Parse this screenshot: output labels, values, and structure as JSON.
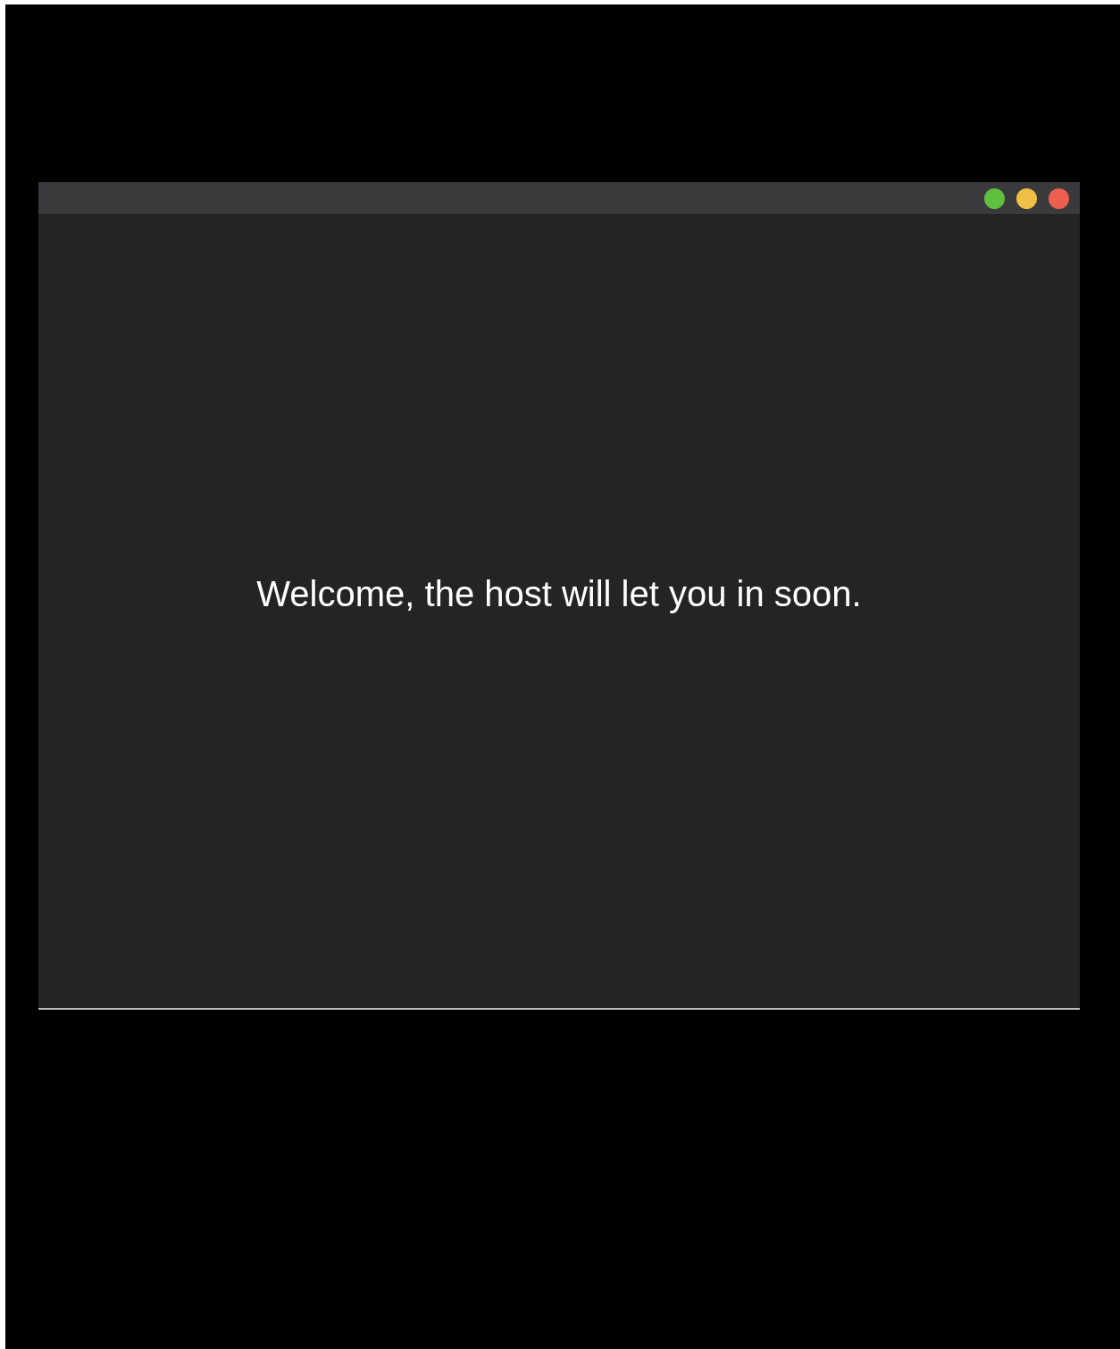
{
  "window": {
    "controls": [
      {
        "color": "#5fbf3f"
      },
      {
        "color": "#f0bf45"
      },
      {
        "color": "#ec5f4f"
      }
    ]
  },
  "message": "Welcome, the host will let you in soon."
}
